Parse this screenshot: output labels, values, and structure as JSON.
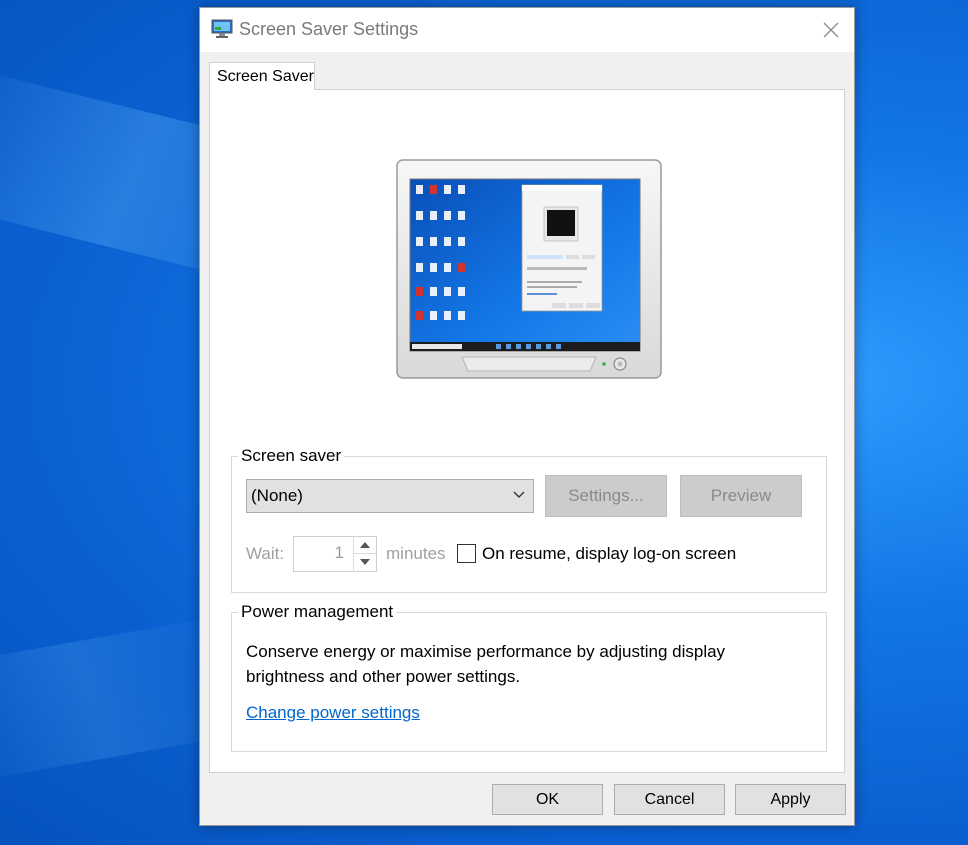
{
  "window": {
    "title": "Screen Saver Settings"
  },
  "tabs": [
    {
      "label": "Screen Saver",
      "active": true
    }
  ],
  "screen_saver_group": {
    "legend": "Screen saver",
    "selected": "(None)",
    "settings_label": "Settings...",
    "preview_label": "Preview",
    "wait_label": "Wait:",
    "wait_value": "1",
    "minutes_label": "minutes",
    "resume_label": "On resume, display log-on screen",
    "resume_checked": false
  },
  "power_group": {
    "legend": "Power management",
    "description": "Conserve energy or maximise performance by adjusting display brightness and other power settings.",
    "link": "Change power settings"
  },
  "buttons": {
    "ok": "OK",
    "cancel": "Cancel",
    "apply": "Apply"
  },
  "colors": {
    "link": "#0066cc",
    "accent": "#0078d7",
    "desktop": "#1277e6"
  },
  "icons": [
    "screen-saver-app-icon",
    "close-icon",
    "chevron-down-icon",
    "spin-up-icon",
    "spin-down-icon",
    "monitor-preview-icon"
  ]
}
